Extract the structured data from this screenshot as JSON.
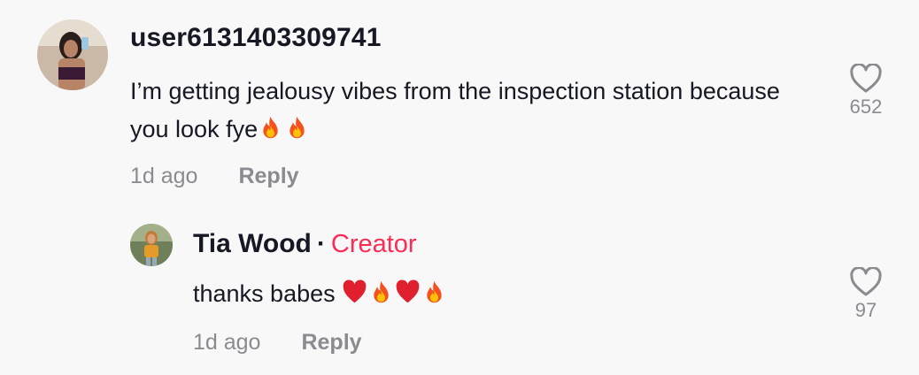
{
  "comments": [
    {
      "username": "user6131403309741",
      "text": "I’m getting jealousy vibes from the inspection station because you look fye",
      "emojis": [
        "fire-icon",
        "fire-icon"
      ],
      "time": "1d ago",
      "reply_label": "Reply",
      "like_count": "652"
    },
    {
      "username": "Tia Wood",
      "separator": "·",
      "creator_badge": "Creator",
      "text": "thanks babes",
      "emojis": [
        "heart-icon",
        "fire-icon",
        "heart-icon",
        "fire-icon"
      ],
      "time": "1d ago",
      "reply_label": "Reply",
      "like_count": "97"
    }
  ],
  "colors": {
    "background": "#f8f8f8",
    "text": "#161823",
    "muted": "#8a8b91",
    "creator": "#fe2c55"
  }
}
